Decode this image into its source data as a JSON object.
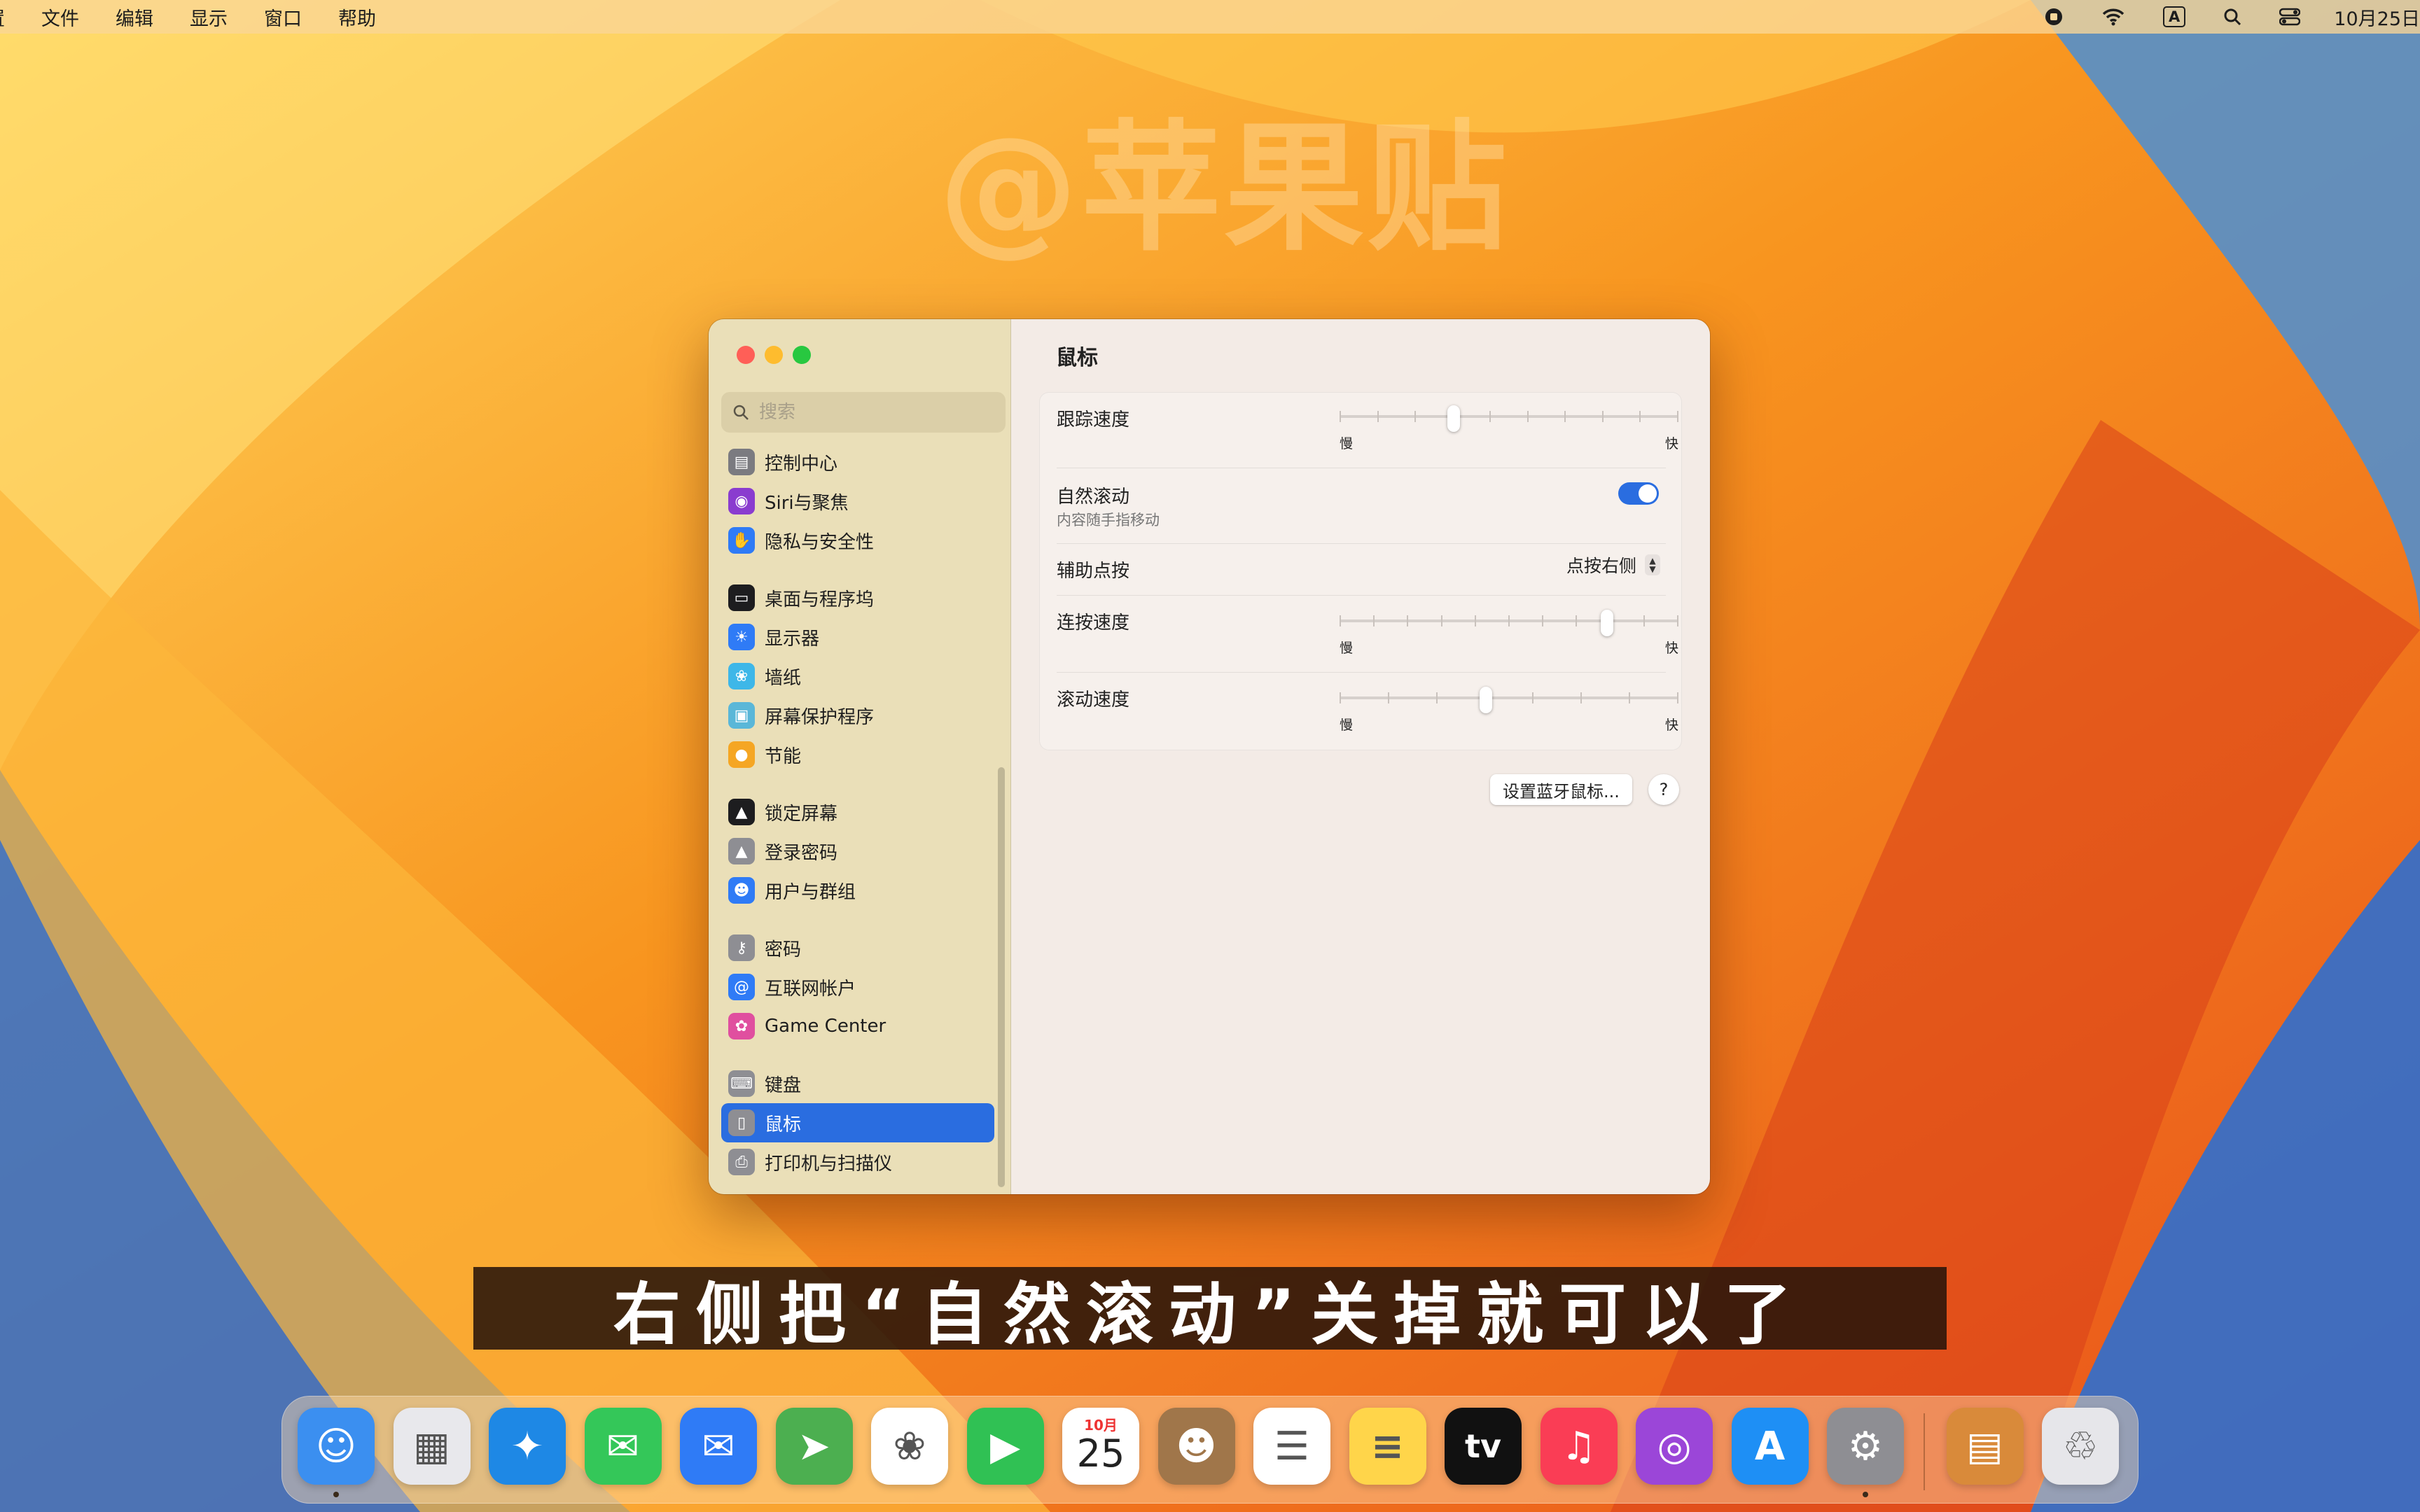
{
  "menubar": {
    "app_fragment": "置",
    "menus": [
      "文件",
      "编辑",
      "显示",
      "窗口",
      "帮助"
    ],
    "input_method": "A",
    "clock": "10月25日"
  },
  "watermark": "@苹果贴",
  "window": {
    "search_placeholder": "搜索",
    "sidebar": [
      {
        "label": "控制中心",
        "icon": "control-center-icon",
        "color": "#7b7b80",
        "glyph": "▤",
        "group_start": false
      },
      {
        "label": "Siri与聚焦",
        "icon": "siri-icon",
        "color": "#8a3ccf",
        "glyph": "◉",
        "group_start": false
      },
      {
        "label": "隐私与安全性",
        "icon": "hand-icon",
        "color": "#2f7bf6",
        "glyph": "✋",
        "group_start": false
      },
      {
        "label": "桌面与程序坞",
        "icon": "dock-icon",
        "color": "#1d1d1f",
        "glyph": "▭",
        "group_start": true
      },
      {
        "label": "显示器",
        "icon": "display-icon",
        "color": "#2f7bf6",
        "glyph": "☀",
        "group_start": false
      },
      {
        "label": "墙纸",
        "icon": "wallpaper-icon",
        "color": "#3eb7e8",
        "glyph": "❀",
        "group_start": false
      },
      {
        "label": "屏幕保护程序",
        "icon": "screensaver-icon",
        "color": "#5ab7d8",
        "glyph": "▣",
        "group_start": false
      },
      {
        "label": "节能",
        "icon": "energy-icon",
        "color": "#f5a623",
        "glyph": "●",
        "group_start": false
      },
      {
        "label": "锁定屏幕",
        "icon": "lock-screen-icon",
        "color": "#1d1d1f",
        "glyph": "▲",
        "group_start": true
      },
      {
        "label": "登录密码",
        "icon": "lock-icon",
        "color": "#8e8e93",
        "glyph": "▲",
        "group_start": false
      },
      {
        "label": "用户与群组",
        "icon": "users-icon",
        "color": "#2f7bf6",
        "glyph": "☻",
        "group_start": false
      },
      {
        "label": "密码",
        "icon": "key-icon",
        "color": "#8e8e93",
        "glyph": "⚷",
        "group_start": true
      },
      {
        "label": "互联网帐户",
        "icon": "at-icon",
        "color": "#2f7bf6",
        "glyph": "@",
        "group_start": false
      },
      {
        "label": "Game Center",
        "icon": "game-center-icon",
        "color": "#e04f9f",
        "glyph": "✿",
        "group_start": false
      },
      {
        "label": "键盘",
        "icon": "keyboard-icon",
        "color": "#8e8e93",
        "glyph": "⌨",
        "group_start": true
      },
      {
        "label": "鼠标",
        "icon": "mouse-icon",
        "color": "#8e8e93",
        "glyph": "▯",
        "group_start": false,
        "selected": true
      },
      {
        "label": "打印机与扫描仪",
        "icon": "printer-icon",
        "color": "#8e8e93",
        "glyph": "⎙",
        "group_start": false
      }
    ],
    "title": "鼠标",
    "settings": {
      "tracking_speed": {
        "label": "跟踪速度",
        "slow": "慢",
        "fast": "快",
        "value_fraction": 0.33,
        "ticks": 10
      },
      "natural_scrolling": {
        "label": "自然滚动",
        "sub": "内容随手指移动",
        "on": true
      },
      "secondary_click": {
        "label": "辅助点按",
        "value": "点按右侧"
      },
      "double_click_speed": {
        "label": "连按速度",
        "slow": "慢",
        "fast": "快",
        "value_fraction": 0.8,
        "ticks": 11
      },
      "scroll_speed": {
        "label": "滚动速度",
        "slow": "慢",
        "fast": "快",
        "value_fraction": 0.43,
        "ticks": 8
      }
    },
    "bluetooth_button": "设置蓝牙鼠标...",
    "help_button": "?"
  },
  "subtitle": "右侧把“自然滚动”关掉就可以了",
  "dock": {
    "items": [
      {
        "name": "finder",
        "color": "#3b8ff0",
        "glyph": "☺",
        "running": true
      },
      {
        "name": "launchpad",
        "color": "#e8e8ec",
        "glyph": "▦",
        "running": false
      },
      {
        "name": "safari",
        "color": "#1e88e5",
        "glyph": "✦",
        "running": false
      },
      {
        "name": "messages",
        "color": "#34c759",
        "glyph": "✉",
        "running": false
      },
      {
        "name": "mail",
        "color": "#2f7bf6",
        "glyph": "✉",
        "running": false
      },
      {
        "name": "maps",
        "color": "#4caf50",
        "glyph": "➤",
        "running": false
      },
      {
        "name": "photos",
        "color": "#ffffff",
        "glyph": "❀",
        "running": false
      },
      {
        "name": "facetime",
        "color": "#30c154",
        "glyph": "▶",
        "running": false
      },
      {
        "name": "calendar",
        "color": "#ffffff",
        "glyph": "25",
        "month": "10月",
        "running": false
      },
      {
        "name": "contacts",
        "color": "#a0764a",
        "glyph": "☻",
        "running": false
      },
      {
        "name": "reminders",
        "color": "#ffffff",
        "glyph": "☰",
        "running": false
      },
      {
        "name": "notes",
        "color": "#ffd54a",
        "glyph": "≡",
        "running": false
      },
      {
        "name": "apple-tv",
        "color": "#111111",
        "glyph": "tv",
        "running": false
      },
      {
        "name": "music",
        "color": "#fa3d55",
        "glyph": "♫",
        "running": false
      },
      {
        "name": "podcasts",
        "color": "#9b46d8",
        "glyph": "◎",
        "running": false
      },
      {
        "name": "app-store",
        "color": "#1e8ff5",
        "glyph": "A",
        "running": false
      },
      {
        "name": "system-settings",
        "color": "#8e8e93",
        "glyph": "⚙",
        "running": true
      },
      {
        "name": "downloads-stack",
        "color": "#d98a3a",
        "glyph": "▤",
        "running": false
      },
      {
        "name": "trash",
        "color": "#e6e6ea",
        "glyph": "♲",
        "running": false
      }
    ]
  }
}
